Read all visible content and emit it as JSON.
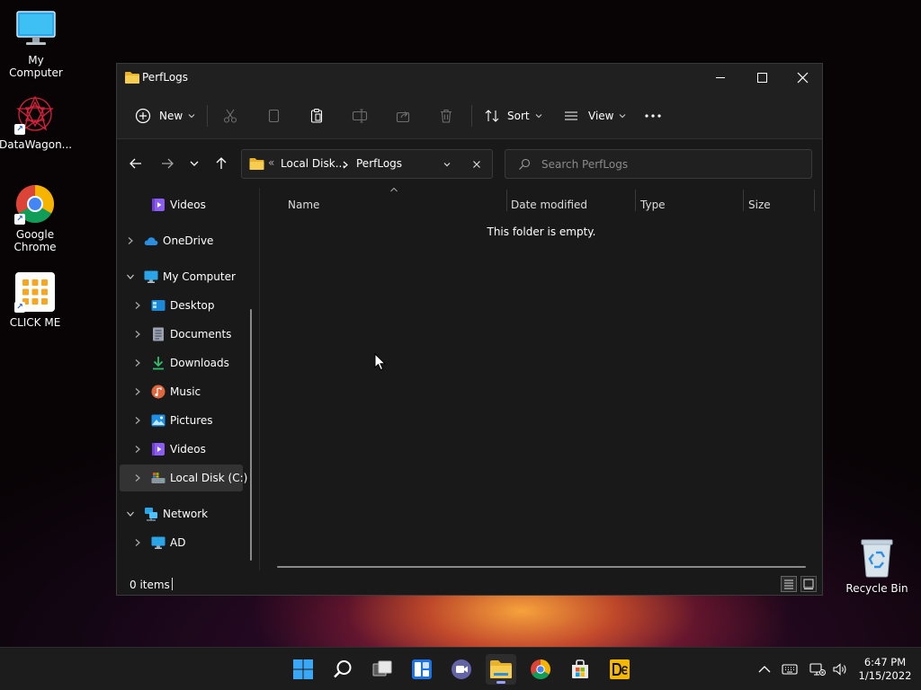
{
  "desktop": {
    "icons": [
      {
        "label": "My Computer"
      },
      {
        "label": "DataWagon..."
      },
      {
        "label": "Google Chrome"
      },
      {
        "label": "CLICK ME"
      }
    ],
    "recycle_bin": {
      "label": "Recycle Bin"
    }
  },
  "window": {
    "title": "PerfLogs",
    "toolbar": {
      "new_label": "New",
      "sort_label": "Sort",
      "view_label": "View"
    },
    "address": {
      "overflow": "«",
      "segments": [
        "Local Disk...",
        "PerfLogs"
      ]
    },
    "search": {
      "placeholder": "Search PerfLogs"
    },
    "nav_pane": {
      "items": [
        {
          "label": "Videos"
        },
        {
          "label": "OneDrive"
        },
        {
          "label": "My Computer"
        },
        {
          "label": "Desktop"
        },
        {
          "label": "Documents"
        },
        {
          "label": "Downloads"
        },
        {
          "label": "Music"
        },
        {
          "label": "Pictures"
        },
        {
          "label": "Videos"
        },
        {
          "label": "Local Disk (C:)"
        },
        {
          "label": "Network"
        },
        {
          "label": "AD"
        }
      ]
    },
    "columns": {
      "name": "Name",
      "date_modified": "Date modified",
      "type": "Type",
      "size": "Size"
    },
    "empty_message": "This folder is empty.",
    "status": {
      "items": "0 items"
    }
  },
  "taskbar": {
    "clock": {
      "time": "6:47 PM",
      "date": "1/15/2022"
    }
  },
  "colors": {
    "window_bg": "#191919",
    "chrome_bg": "#202020",
    "folder_yellow": "#f3c13a",
    "accent_blue": "#4cc2ff",
    "taskbar_bg": "#1c1c1c"
  }
}
